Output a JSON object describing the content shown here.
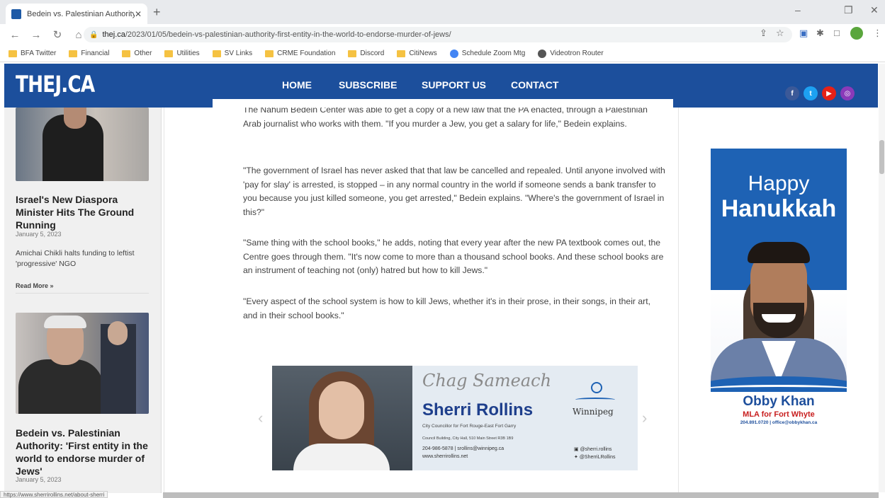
{
  "browser": {
    "tab_title": "Bedein vs. Palestinian Authority",
    "url_domain": "thej.ca",
    "url_path": "/2023/01/05/bedein-vs-palestinian-authority-first-entity-in-the-world-to-endorse-murder-of-jews/",
    "bookmarks": [
      {
        "label": "BFA Twitter",
        "icon": "folder"
      },
      {
        "label": "Financial",
        "icon": "folder"
      },
      {
        "label": "Other",
        "icon": "folder"
      },
      {
        "label": "Utilities",
        "icon": "folder"
      },
      {
        "label": "SV Links",
        "icon": "folder"
      },
      {
        "label": "CRME Foundation",
        "icon": "folder"
      },
      {
        "label": "Discord",
        "icon": "folder"
      },
      {
        "label": "CitiNews",
        "icon": "folder"
      },
      {
        "label": "Schedule Zoom Mtg",
        "icon": "globe"
      },
      {
        "label": "Videotron Router",
        "icon": "globe-dark"
      }
    ],
    "status_url": "https://www.sherrirollins.net/about-sherri"
  },
  "site": {
    "logo": "THEJ.CA",
    "nav": [
      "HOME",
      "SUBSCRIBE",
      "SUPPORT US",
      "CONTACT"
    ],
    "social": [
      "facebook-icon",
      "twitter-icon",
      "youtube-icon",
      "instagram-icon"
    ],
    "colors": {
      "header": "#1c4f9c",
      "facebook": "#3b5998",
      "twitter": "#1da1f2",
      "youtube": "#e62117",
      "instagram": "#8a3ab9"
    }
  },
  "sidebar": {
    "articles": [
      {
        "title": "Israel's New Diaspora Minister Hits The Ground Running",
        "date": "January 5, 2023",
        "excerpt": "Amichai Chikli halts funding to leftist 'progressive' NGO",
        "read_more": "Read More »"
      },
      {
        "title": "Bedein vs. Palestinian Authority: 'First entity in the world to endorse murder of Jews'",
        "date": "January 5, 2023"
      }
    ]
  },
  "article": {
    "paragraphs": [
      "The Nahum Bedein Center was able to get a copy of a new law that the PA enacted, through a Palestinian Arab journalist who works with them. \"If you murder a Jew, you get a salary for life,\" Bedein explains.",
      "\"The government of Israel has never asked that that law be cancelled and repealed. Until anyone involved with 'pay for slay' is arrested, is stopped – in any normal country in the world if someone sends a bank transfer to you because you just killed someone, you get arrested,\" Bedein explains. \"Where's the government of Israel in this?\"",
      "\"Same thing with the school books,\" he adds, noting that every year after the new PA textbook comes out, the Centre goes through them. \"It's now come to more than a thousand school books. And these school books are an instrument of teaching not (only) hatred but how to kill Jews.\"",
      "\"Every aspect of the school system is how to kill Jews, whether it's in their prose, in their songs, in their art, and in their school books.\""
    ]
  },
  "banner_ad": {
    "greeting": "Chag Sameach",
    "name": "Sherri Rollins",
    "role": "City Councillor for Fort Rouge-East Fort Garry",
    "address": "Council Building, City Hall, 510 Main Street  R3B 1B9",
    "phone_email": "204-986-5878  |  srollins@winnipeg.ca",
    "website": "www.sherrirollins.net",
    "city_logo": "Winnipeg",
    "social_fb": "@sherri.rollins",
    "social_tw": "@SherriLRollins"
  },
  "side_ad": {
    "greeting_line1": "Happy",
    "greeting_line2": "Hanukkah",
    "name": "Obby Khan",
    "role": "MLA for Fort Whyte",
    "contact": "204.891.0720 | office@obbykhan.ca"
  }
}
